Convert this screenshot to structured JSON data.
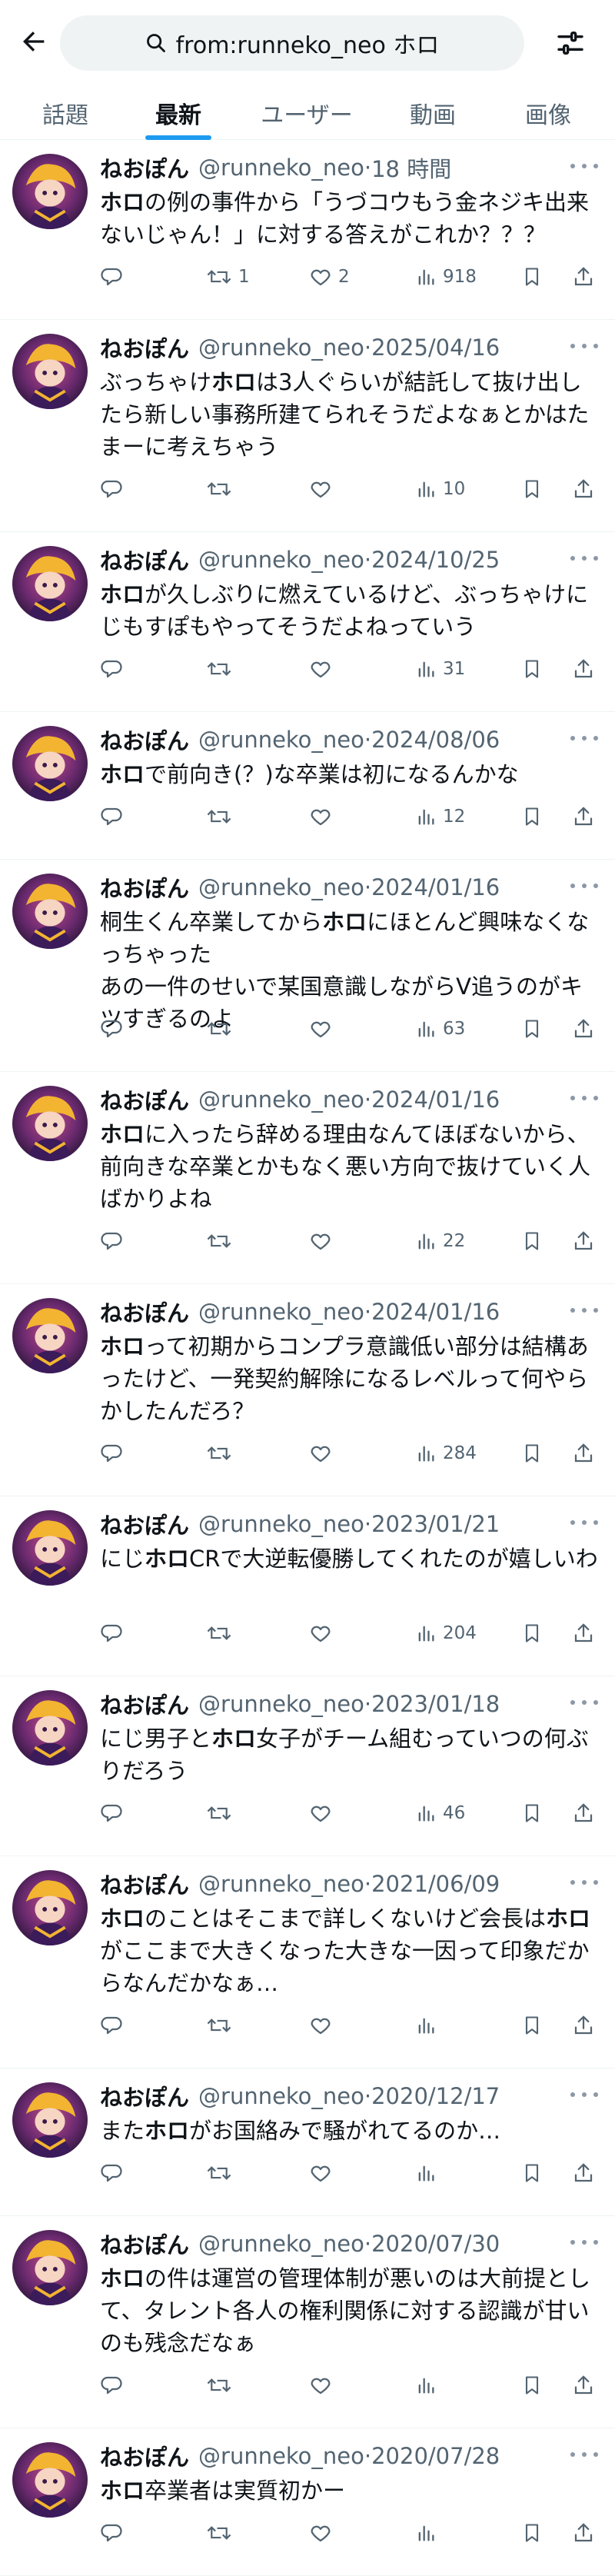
{
  "search": {
    "query": "from:runneko_neo ホロ"
  },
  "tabs": [
    {
      "label": "話題"
    },
    {
      "label": "最新"
    },
    {
      "label": "ユーザー"
    },
    {
      "label": "動画"
    },
    {
      "label": "画像"
    }
  ],
  "active_tab": "最新",
  "colors": {
    "accent": "#1d9bf0",
    "text": "#0f1419",
    "secondary": "#536471",
    "search_bg": "#eff3f4"
  },
  "icons": {
    "back": "arrow-left-icon",
    "search": "search-icon",
    "filter": "sliders-icon"
  },
  "tweets": [
    {
      "name": "ねおぽん",
      "handle": "@runneko_neo",
      "time": "18 時間",
      "segments": [
        "",
        "ホロ",
        "の例の事件から「うづコウもう金ネジキ出来ないじゃん！」に対する答えがこれか？？？"
      ],
      "replies": "",
      "retweets": "1",
      "likes": "2",
      "views": "918"
    },
    {
      "name": "ねおぽん",
      "handle": "@runneko_neo",
      "time": "2025/04/16",
      "segments": [
        "ぶっちゃけ",
        "ホロ",
        "は3人ぐらいが結託して抜け出したら新しい事務所建てられそうだよなぁとかはたまーに考えちゃう"
      ],
      "replies": "",
      "retweets": "",
      "likes": "",
      "views": "10"
    },
    {
      "name": "ねおぽん",
      "handle": "@runneko_neo",
      "time": "2024/10/25",
      "segments": [
        "",
        "ホロ",
        "が久しぶりに燃えているけど、ぶっちゃけにじもすぽもやってそうだよねっていう"
      ],
      "replies": "",
      "retweets": "",
      "likes": "",
      "views": "31"
    },
    {
      "name": "ねおぽん",
      "handle": "@runneko_neo",
      "time": "2024/08/06",
      "segments": [
        "",
        "ホロ",
        "で前向き(？)な卒業は初になるんかな"
      ],
      "replies": "",
      "retweets": "",
      "likes": "",
      "views": "12"
    },
    {
      "name": "ねおぽん",
      "handle": "@runneko_neo",
      "time": "2024/01/16",
      "segments": [
        "桐生くん卒業してから",
        "ホロ",
        "にほとんど興味なくなっちゃった\nあの一件のせいで某国意識しながらV追うのがキツすぎるのよ"
      ],
      "replies": "",
      "retweets": "",
      "likes": "",
      "views": "63"
    },
    {
      "name": "ねおぽん",
      "handle": "@runneko_neo",
      "time": "2024/01/16",
      "segments": [
        "",
        "ホロ",
        "に入ったら辞める理由なんてほぼないから、前向きな卒業とかもなく悪い方向で抜けていく人ばかりよね"
      ],
      "replies": "",
      "retweets": "",
      "likes": "",
      "views": "22"
    },
    {
      "name": "ねおぽん",
      "handle": "@runneko_neo",
      "time": "2024/01/16",
      "segments": [
        "",
        "ホロ",
        "って初期からコンプラ意識低い部分は結構あったけど、一発契約解除になるレベルって何やらかしたんだろ？"
      ],
      "replies": "",
      "retweets": "",
      "likes": "",
      "views": "284"
    },
    {
      "name": "ねおぽん",
      "handle": "@runneko_neo",
      "time": "2023/01/21",
      "segments": [
        "にじ",
        "ホロ",
        "CRで大逆転優勝してくれたのが嬉しいわ"
      ],
      "replies": "",
      "retweets": "",
      "likes": "",
      "views": "204"
    },
    {
      "name": "ねおぽん",
      "handle": "@runneko_neo",
      "time": "2023/01/18",
      "segments": [
        "にじ男子と",
        "ホロ",
        "女子がチーム組むっていつの何ぶりだろう"
      ],
      "replies": "",
      "retweets": "",
      "likes": "",
      "views": "46"
    },
    {
      "name": "ねおぽん",
      "handle": "@runneko_neo",
      "time": "2021/06/09",
      "segments": [
        "",
        "ホロ",
        "のことはそこまで詳しくないけど会長は",
        "ホロ",
        "がここまで大きくなった大きな一因って印象だからなんだかなぁ…"
      ],
      "replies": "",
      "retweets": "",
      "likes": "",
      "views": ""
    },
    {
      "name": "ねおぽん",
      "handle": "@runneko_neo",
      "time": "2020/12/17",
      "segments": [
        "また",
        "ホロ",
        "がお国絡みで騒がれてるのか…"
      ],
      "replies": "",
      "retweets": "",
      "likes": "",
      "views": ""
    },
    {
      "name": "ねおぽん",
      "handle": "@runneko_neo",
      "time": "2020/07/30",
      "segments": [
        "",
        "ホロ",
        "の件は運営の管理体制が悪いのは大前提として、タレント各人の権利関係に対する認識が甘いのも残念だなぁ"
      ],
      "replies": "",
      "retweets": "",
      "likes": "",
      "views": ""
    },
    {
      "name": "ねおぽん",
      "handle": "@runneko_neo",
      "time": "2020/07/28",
      "segments": [
        "",
        "ホロ",
        "卒業者は実質初かー"
      ],
      "replies": "",
      "retweets": "",
      "likes": "",
      "views": ""
    }
  ]
}
